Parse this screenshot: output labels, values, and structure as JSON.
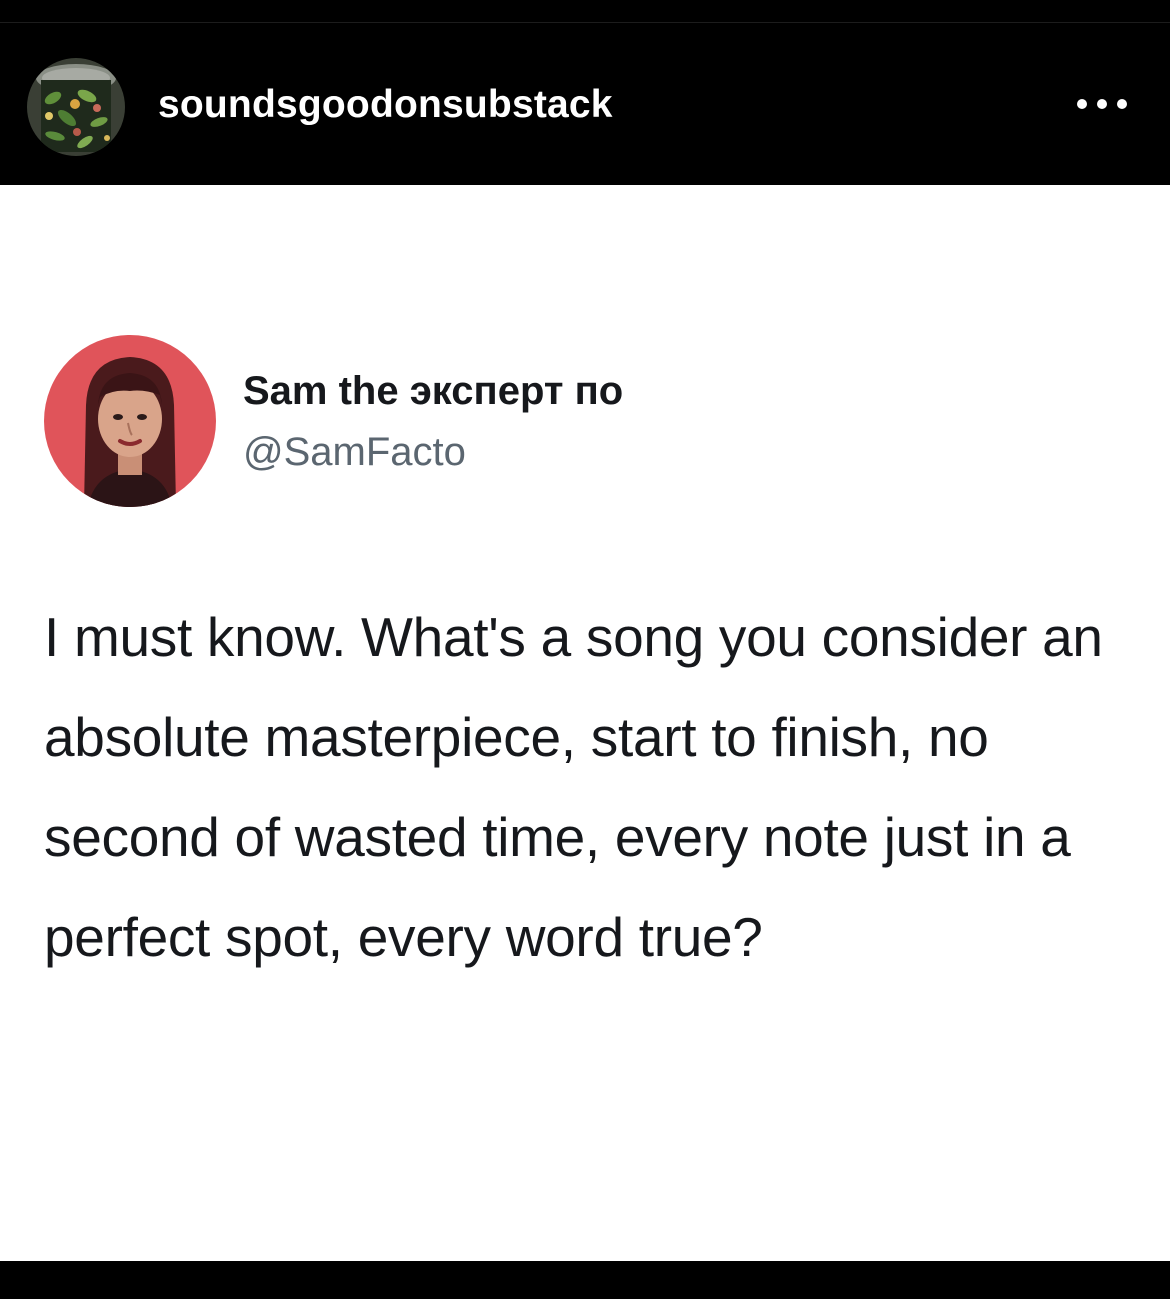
{
  "post": {
    "account_username": "soundsgoodonsubstack",
    "more_icon": "more-horizontal-icon"
  },
  "tweet": {
    "display_name": "Sam the эксперт по",
    "handle": "@SamFacto",
    "text": "I must know. What's a song you consider an absolute masterpiece, start to finish, no second of wasted time, every note just in a perfect spot, every word true?"
  },
  "colors": {
    "header_background": "#000000",
    "tweet_background": "#ffffff",
    "tweet_text": "#16181c",
    "handle_text": "#5b6670",
    "avatar_backdrop": "#e0545a"
  }
}
